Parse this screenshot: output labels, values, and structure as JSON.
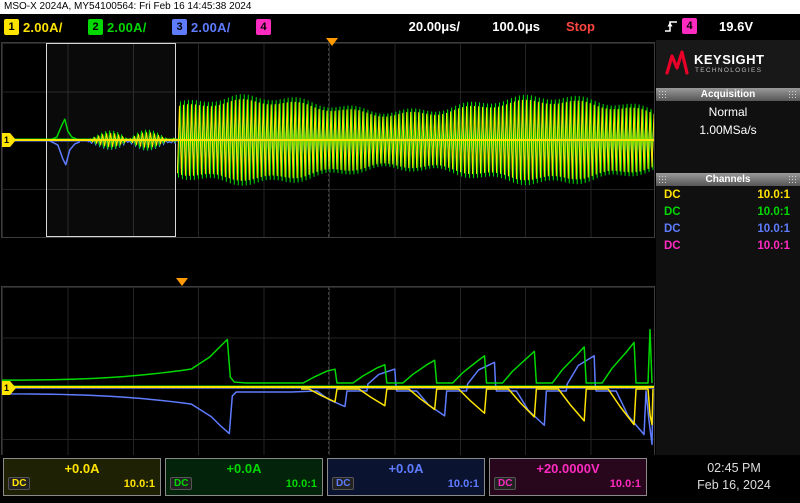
{
  "colors": {
    "ch1": "#ffe400",
    "ch2": "#00d800",
    "ch3": "#5f7cff",
    "ch4": "#ff2bc0",
    "run_stop": "#ff4540",
    "marker_orange": "#ff9a00",
    "keysight_red": "#e90029"
  },
  "titlebar": {
    "text": "MSO-X 2024A, MY54100564: Fri Feb 16 14:45:38 2024"
  },
  "statusbar": {
    "ch1_badge": "1",
    "ch1_scale": "2.00A/",
    "ch2_badge": "2",
    "ch2_scale": "2.00A/",
    "ch3_badge": "3",
    "ch3_scale": "2.00A/",
    "ch4_badge": "4",
    "ch4_scale": "",
    "timebase": "20.00μs/",
    "delay": "100.0μs",
    "run_state": "Stop",
    "trigger_icon": "edge-rising",
    "trigger_source": "4",
    "trigger_level": "19.6V"
  },
  "sidebar": {
    "brand": "KEYSIGHT",
    "brand_sub": "TECHNOLOGIES",
    "acquisition_header": "Acquisition",
    "acq_mode": "Normal",
    "sample_rate": "1.00MSa/s",
    "channels_header": "Channels",
    "rows": [
      {
        "coupling": "DC",
        "probe": "10.0:1"
      },
      {
        "coupling": "DC",
        "probe": "10.0:1"
      },
      {
        "coupling": "DC",
        "probe": "10.0:1"
      },
      {
        "coupling": "DC",
        "probe": "10.0:1"
      }
    ]
  },
  "scope": {
    "ground_label": "1"
  },
  "bottombar": {
    "boxes": [
      {
        "value": "+0.0A",
        "coupling": "DC",
        "probe": "10.0:1"
      },
      {
        "value": "+0.0A",
        "coupling": "DC",
        "probe": "10.0:1"
      },
      {
        "value": "+0.0A",
        "coupling": "DC",
        "probe": "10.0:1"
      },
      {
        "value": "+20.0000V",
        "coupling": "DC",
        "probe": "10.0:1"
      }
    ],
    "time": "02:45 PM",
    "date": "Feb 16, 2024"
  }
}
